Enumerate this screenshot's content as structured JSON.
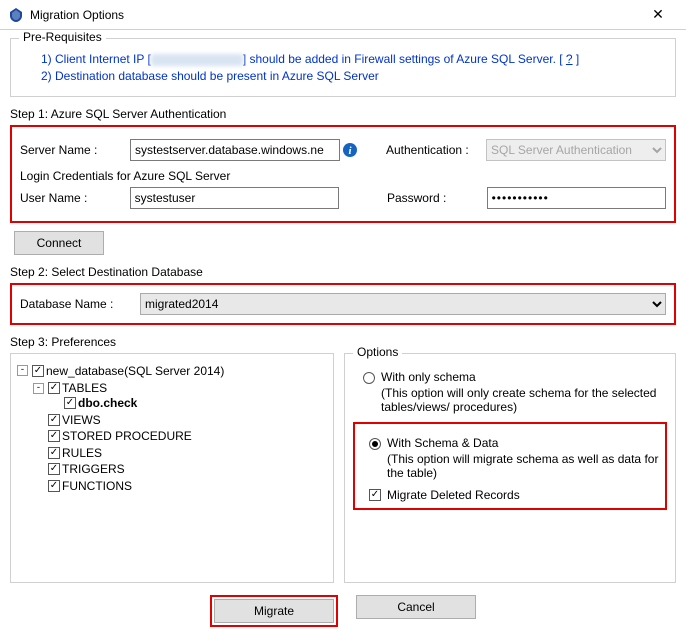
{
  "window": {
    "title": "Migration Options"
  },
  "prereq": {
    "heading": "Pre-Requisites",
    "line1_a": "1) Client Internet IP [",
    "line1_b": "] should be added in Firewall settings of Azure SQL Server. [ ",
    "help": "?",
    "line1_c": " ]",
    "line2": "2) Destination database should be present in Azure SQL Server"
  },
  "step1": {
    "label": "Step 1: Azure SQL Server Authentication",
    "server_label": "Server Name :",
    "server_value": "systestserver.database.windows.ne",
    "auth_label": "Authentication :",
    "auth_value": "SQL Server Authentication",
    "creds_label": "Login Credentials for Azure SQL Server",
    "user_label": "User Name :",
    "user_value": "systestuser",
    "pass_label": "Password :",
    "pass_value": "•••••••••••",
    "connect": "Connect"
  },
  "step2": {
    "label": "Step 2: Select Destination Database",
    "db_label": "Database Name :",
    "db_value": "migrated2014"
  },
  "step3": {
    "label": "Step 3: Preferences",
    "options_label": "Options",
    "tree": {
      "root": "new_database(SQL Server 2014)",
      "tables": "TABLES",
      "dbo_check": "dbo.check",
      "views": "VIEWS",
      "sp": "STORED PROCEDURE",
      "rules": "RULES",
      "triggers": "TRIGGERS",
      "functions": "FUNCTIONS"
    },
    "opt1_label": "With only schema",
    "opt1_desc": "(This option will only create schema for the  selected tables/views/ procedures)",
    "opt2_label": "With Schema & Data",
    "opt2_desc": "(This option will migrate schema as well as data for the table)",
    "migrate_deleted": "Migrate Deleted Records"
  },
  "footer": {
    "migrate": "Migrate",
    "cancel": "Cancel"
  }
}
